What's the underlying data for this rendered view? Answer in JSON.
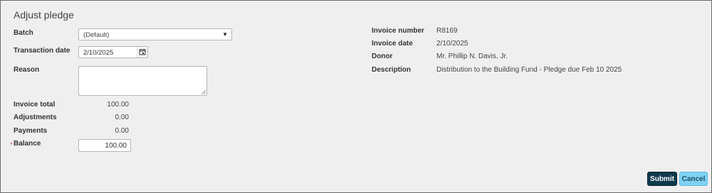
{
  "dialog": {
    "title": "Adjust pledge"
  },
  "form": {
    "batch_label": "Batch",
    "batch_value": "(Default)",
    "transaction_date_label": "Transaction date",
    "transaction_date_value": "2/10/2025",
    "reason_label": "Reason",
    "reason_value": "",
    "invoice_total_label": "Invoice total",
    "invoice_total_value": "100.00",
    "adjustments_label": "Adjustments",
    "adjustments_value": "0.00",
    "payments_label": "Payments",
    "payments_value": "0.00",
    "balance_label": "Balance",
    "balance_value": "100.00",
    "required_marker": "*"
  },
  "details": {
    "invoice_number_label": "Invoice number",
    "invoice_number_value": "R8169",
    "invoice_date_label": "Invoice date",
    "invoice_date_value": "2/10/2025",
    "donor_label": "Donor",
    "donor_value": "Mr. Phillip N. Davis, Jr.",
    "description_label": "Description",
    "description_value": "Distribution to the Building Fund - Pledge due Feb 10 2025"
  },
  "actions": {
    "submit_label": "Submit",
    "cancel_label": "Cancel"
  },
  "colors": {
    "submit_bg": "#0e3a4d",
    "cancel_bg": "#7fd2f5",
    "required": "#d9534f"
  }
}
